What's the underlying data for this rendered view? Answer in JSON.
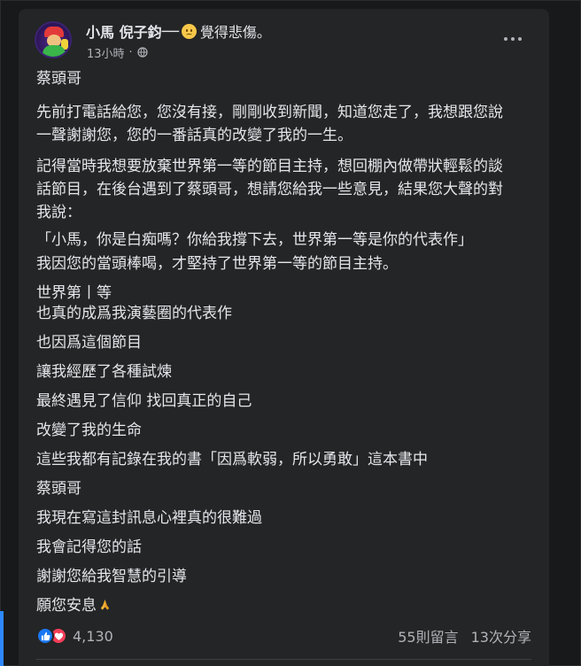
{
  "post": {
    "author": "小馬 倪子鈞",
    "separator": "──",
    "feeling": "覺得悲傷。",
    "feeling_icon": "sad-face-emoji",
    "time": "13小時",
    "dot": "·",
    "privacy_icon": "globe-icon",
    "lines": [
      "蔡頭哥",
      "先前打電話給您，您沒有接，剛剛收到新聞，知道您走了，我想跟您說",
      "一聲謝謝您，您的一番話真的改變了我的一生。",
      "記得當時我想要放棄世界第一等的節目主持，想回棚內做帶狀輕鬆的談",
      "話節目，在後台遇到了蔡頭哥，想請您給我一些意見，結果您大聲的對",
      "我說：",
      "「小馬，你是白痴嗎？你給我撐下去，世界第一等是你的代表作」",
      "我因您的當頭棒喝，才堅持了世界第一等的節目主持。",
      "世界第丨等",
      "也真的成爲我演藝圈的代表作",
      "也因爲這個節目",
      "讓我經歷了各種試煉",
      "最終遇見了信仰 找回真正的自己",
      "改變了我的生命",
      "這些我都有記錄在我的書「因爲軟弱，所以勇敢」這本書中",
      "蔡頭哥",
      "我現在寫這封訊息心裡真的很難過",
      "我會記得您的話",
      "謝謝您給我智慧的引導",
      "願您安息"
    ],
    "final_emoji": "folded-hands-emoji"
  },
  "reactions": {
    "icons": [
      "like-icon",
      "love-icon"
    ],
    "count": "4,130"
  },
  "stats": {
    "comments": "55則留言",
    "shares": "13次分享"
  },
  "colors": {
    "page_bg": "#18191a",
    "card_bg": "#242526",
    "text_primary": "#e4e6eb",
    "text_secondary": "#b0b3b8",
    "like_blue": "#1877f2",
    "love_red": "#f33e58",
    "accent_blue": "#2d88ff"
  }
}
